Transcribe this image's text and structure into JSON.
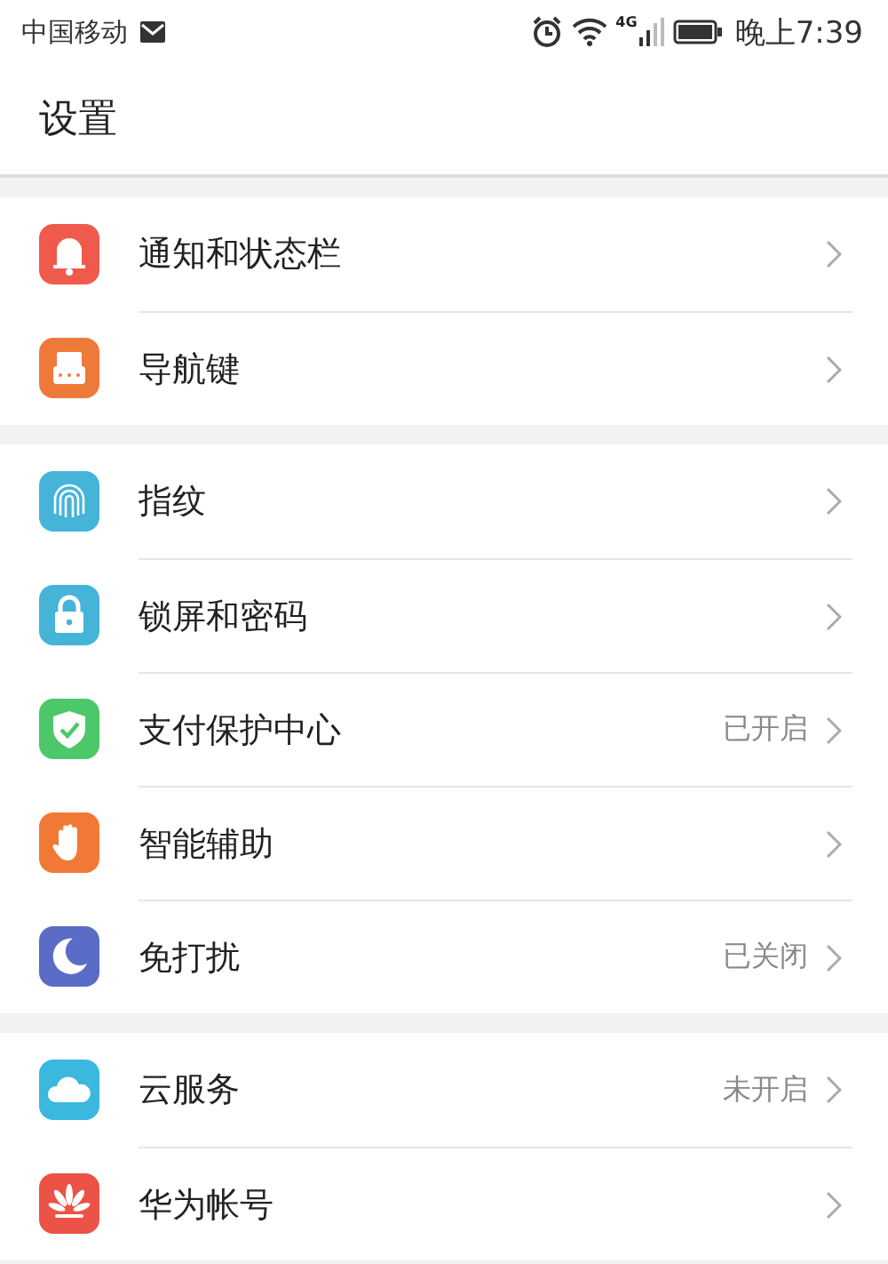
{
  "status_bar": {
    "carrier": "中国移动",
    "network": "4G",
    "time": "晚上7:39"
  },
  "title": "设置",
  "sections": [
    {
      "items": [
        {
          "label": "通知和状态栏",
          "color": "#ef5a4c"
        },
        {
          "label": "导航键",
          "color": "#ee7a3a"
        }
      ]
    },
    {
      "items": [
        {
          "label": "指纹",
          "color": "#45b4d8"
        },
        {
          "label": "锁屏和密码",
          "color": "#45b4d8"
        },
        {
          "label": "支付保护中心",
          "value": "已开启",
          "color": "#4cc76a"
        },
        {
          "label": "智能辅助",
          "color": "#f07a35"
        },
        {
          "label": "免打扰",
          "value": "已关闭",
          "color": "#5b6cc6"
        }
      ]
    },
    {
      "items": [
        {
          "label": "云服务",
          "value": "未开启",
          "color": "#3ab8de"
        },
        {
          "label": "华为帐号",
          "color": "#ec5246"
        }
      ]
    }
  ]
}
